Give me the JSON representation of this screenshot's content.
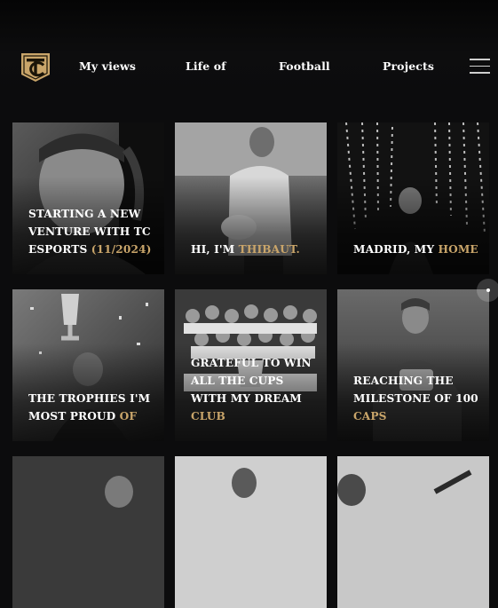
{
  "logo": {
    "icon": "tc-monogram-shield-icon",
    "color": "#c9a56a",
    "letters": "TC"
  },
  "nav": {
    "items": [
      {
        "label": "My views"
      },
      {
        "label": "Life of"
      },
      {
        "label": "Football"
      },
      {
        "label": "Projects"
      }
    ],
    "menu_icon": "hamburger-menu-icon"
  },
  "cards": [
    {
      "main": "Starting a new venture with TC Esports",
      "highlight": "(11/2024)"
    },
    {
      "main": "Hi, I'm",
      "highlight": "Thibaut."
    },
    {
      "main": "Madrid, my",
      "highlight": "home"
    },
    {
      "main": "The trophies I'm most proud",
      "highlight": "of"
    },
    {
      "main": "Grateful to win all the cups with my dream",
      "highlight": "club"
    },
    {
      "main": "Reaching the milestone of 100",
      "highlight": "caps"
    }
  ],
  "colors": {
    "accent": "#c9a56a",
    "background": "#0c0c0d",
    "text": "#ffffff"
  }
}
